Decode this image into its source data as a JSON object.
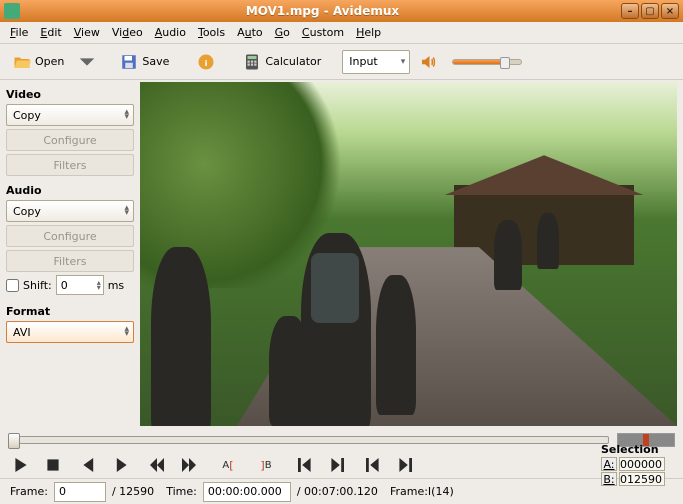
{
  "window": {
    "title": "MOV1.mpg - Avidemux"
  },
  "menu": {
    "file": "File",
    "edit": "Edit",
    "view": "View",
    "video": "Video",
    "audio": "Audio",
    "tools": "Tools",
    "auto": "Auto",
    "go": "Go",
    "custom": "Custom",
    "help": "Help"
  },
  "toolbar": {
    "open": "Open",
    "save": "Save",
    "calculator": "Calculator",
    "input_combo": "Input"
  },
  "sidebar": {
    "video_header": "Video",
    "video_codec": "Copy",
    "configure": "Configure",
    "filters": "Filters",
    "audio_header": "Audio",
    "audio_codec": "Copy",
    "shift_label": "Shift:",
    "shift_value": "0",
    "shift_unit": "ms",
    "format_header": "Format",
    "format_value": "AVI"
  },
  "selection": {
    "header": "Selection",
    "a_label": "A:",
    "a_value": "000000",
    "b_label": "B:",
    "b_value": "012590"
  },
  "status": {
    "frame_label": "Frame:",
    "frame_value": "0",
    "frame_total": "/ 12590",
    "time_label": "Time:",
    "time_value": "00:00:00.000",
    "time_total": "/ 00:07:00.120",
    "frame_type": "Frame:I(14)"
  }
}
